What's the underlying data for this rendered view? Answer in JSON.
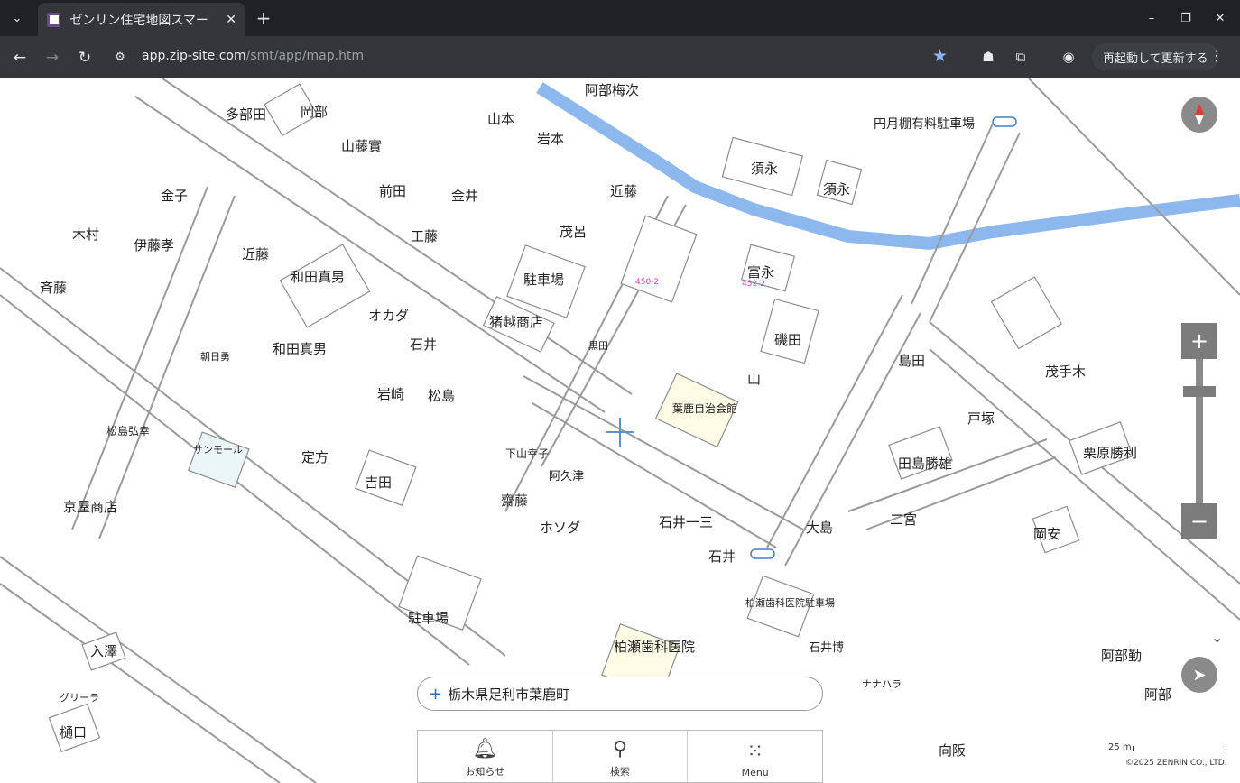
{
  "browser": {
    "tab_title": "ゼンリン住宅地図スマー",
    "url_host": "app.zip-site.com",
    "url_path": "/smt/app/map.htm",
    "relaunch_label": "再起動して更新する",
    "icons": {
      "tab_search": "chevron-down-icon",
      "close": "close-icon",
      "new_tab": "plus-icon",
      "back": "arrow-left-icon",
      "forward": "arrow-right-icon",
      "reload": "reload-icon",
      "bookmark": "star-icon",
      "profile": "profile-icon",
      "menu": "kebab-icon"
    }
  },
  "map": {
    "address": "栃木県足利市葉鹿町",
    "labels": {
      "tatabe": "多部田",
      "okabe": "岡部",
      "yamamoto": "山本",
      "iwamoto": "岩本",
      "abemasatsugu": "阿部梅次",
      "sue1": "須永",
      "sue2": "須永",
      "tomie": "富永",
      "isoda": "磯田",
      "yama": "山",
      "shimada": "島田",
      "tozuka": "戸塚",
      "kondo": "近藤",
      "shigeru": "茂呂",
      "chushajo1": "駐車場",
      "chushajo2": "駐車場",
      "kaneko": "金子",
      "kimura": "木村",
      "itotakashi": "伊藤孝",
      "saito": "斉藤",
      "kondo2": "近藤",
      "wada1": "和田真男",
      "wada2": "和田真男",
      "okada": "オカダ",
      "ishii": "石井",
      "matsushima": "松島",
      "iwasaki": "岩崎",
      "komon": "金井",
      "kudo": "工藤",
      "maeda": "前田",
      "yamafuji": "山藤實",
      "inoseshoten": "猪越商店",
      "sadakata": "定方",
      "yoshida": "吉田",
      "saito2": "齋藤",
      "hosoda": "ホソダ",
      "ishiikazumi": "石井一三",
      "ishii2": "石井",
      "oshima": "大島",
      "ninomiya": "二宮",
      "okayasu": "岡安",
      "abe1": "阿部勤",
      "abe2": "阿部",
      "kuribara": "栗原勝利",
      "shigeteki": "茂手木",
      "kashibashi": "柏瀬歯科医院",
      "kashibashiP": "柏瀬歯科医院駐車場",
      "irisawa": "入澤",
      "higuchi": "樋口",
      "sunmall": "サンモール",
      "kumagaya": "京屋商店",
      "tamura": "田島勝雄",
      "ishiigo": "石井博",
      "nanahara": "ナナハラ",
      "genpai": "向阪",
      "yuu": "朝日勇",
      "community": "葉鹿自治会館",
      "matsumotoyoshi": "松島弘幸",
      "shimoyama": "下山幸子",
      "chiyoda": "円月棚有料駐車場",
      "abekun": "阿久津",
      "kure": "グリーラ",
      "kurohako": "黒田",
      "lot_450": "450-2",
      "lot_452": "452-2"
    }
  },
  "controls": {
    "zoom_in": "+",
    "zoom_out": "−",
    "compass_icon": "compass-icon",
    "locate_icon": "navigation-arrow-icon",
    "chevron_icon": "chevron-down-icon"
  },
  "bottom_menu": {
    "items": [
      {
        "label": "お知らせ",
        "icon": "bell-icon"
      },
      {
        "label": "検索",
        "icon": "search-icon"
      },
      {
        "label": "Menu",
        "icon": "grid-dots-icon"
      }
    ]
  },
  "scale": {
    "label": "25 m"
  },
  "copyright": "©2025 ZENRIN CO., LTD.",
  "colors": {
    "river": "#8db8ee",
    "road": "#9a9a9a",
    "lot_number": "#d93fb2",
    "crosshair": "#5b8fd6"
  }
}
